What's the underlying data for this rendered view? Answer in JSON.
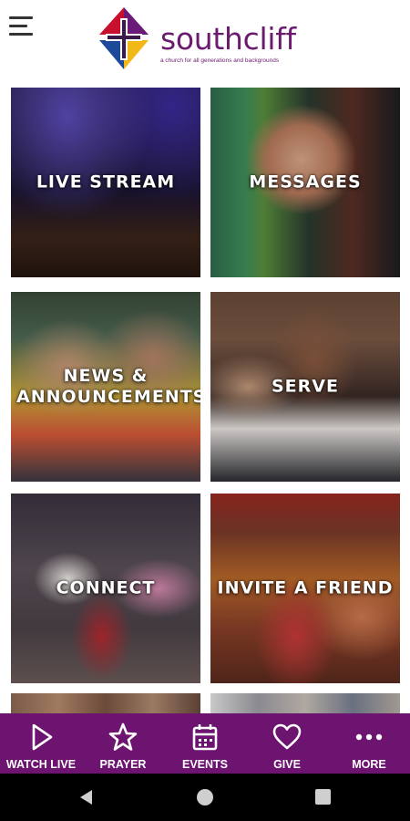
{
  "header": {
    "menu_icon": "hamburger-menu-icon",
    "logo": {
      "name": "southcliff",
      "tagline": "a church for all generations and backgrounds",
      "colors": {
        "purple": "#6b1b6e",
        "red": "#c8102e",
        "yellow": "#f2b81a",
        "blue": "#1e4a9a",
        "violet": "#6a1b7a"
      }
    }
  },
  "tiles": [
    {
      "label": "LIVE STREAM"
    },
    {
      "label": "MESSAGES"
    },
    {
      "label": "NEWS & ANNOUNCEMENTS"
    },
    {
      "label": "SERVE"
    },
    {
      "label": "CONNECT"
    },
    {
      "label": "INVITE A FRIEND"
    },
    {
      "label": ""
    },
    {
      "label": ""
    }
  ],
  "bottom_nav": {
    "background": "#6d1471",
    "items": [
      {
        "label": "WATCH LIVE",
        "icon": "play-icon"
      },
      {
        "label": "PRAYER",
        "icon": "star-icon"
      },
      {
        "label": "EVENTS",
        "icon": "calendar-icon"
      },
      {
        "label": "GIVE",
        "icon": "heart-icon"
      },
      {
        "label": "MORE",
        "icon": "more-dots-icon"
      }
    ]
  },
  "system_nav": {
    "back_icon": "back-triangle-icon",
    "home_icon": "home-circle-icon",
    "recents_icon": "recents-square-icon"
  }
}
